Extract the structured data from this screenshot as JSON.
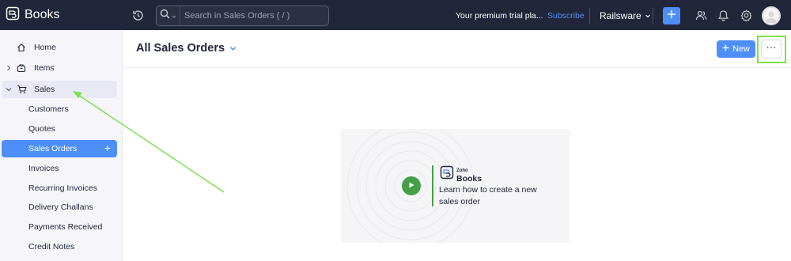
{
  "app": {
    "name": "Books"
  },
  "topbar": {
    "search_placeholder": "Search in Sales Orders ( / )",
    "trial_text": "Your premium trial pla...",
    "subscribe_label": "Subscribe",
    "org_name": "Railsware",
    "icons": [
      "recent-activity-icon",
      "search-icon",
      "plus-icon",
      "users-icon",
      "bell-icon",
      "settings-icon"
    ]
  },
  "sidebar": {
    "items": [
      {
        "label": "Home",
        "icon": "home-icon"
      },
      {
        "label": "Items",
        "icon": "box-icon"
      },
      {
        "label": "Sales",
        "icon": "cart-icon"
      }
    ],
    "sales_items": [
      {
        "label": "Customers"
      },
      {
        "label": "Quotes"
      },
      {
        "label": "Sales Orders",
        "active": true,
        "add_label": "+"
      },
      {
        "label": "Invoices"
      },
      {
        "label": "Recurring Invoices"
      },
      {
        "label": "Delivery Challans"
      },
      {
        "label": "Payments Received"
      },
      {
        "label": "Credit Notes"
      }
    ]
  },
  "main": {
    "title": "All Sales Orders",
    "new_button_label": "New",
    "more_button_label": "···",
    "video": {
      "brand_small": "Zoho",
      "brand": "Books",
      "text": "Learn how to create a new sales order"
    }
  },
  "colors": {
    "topbar_bg": "#22263a",
    "accent": "#4d8ff7",
    "annotation": "#7ee04a",
    "play": "#43a047"
  }
}
